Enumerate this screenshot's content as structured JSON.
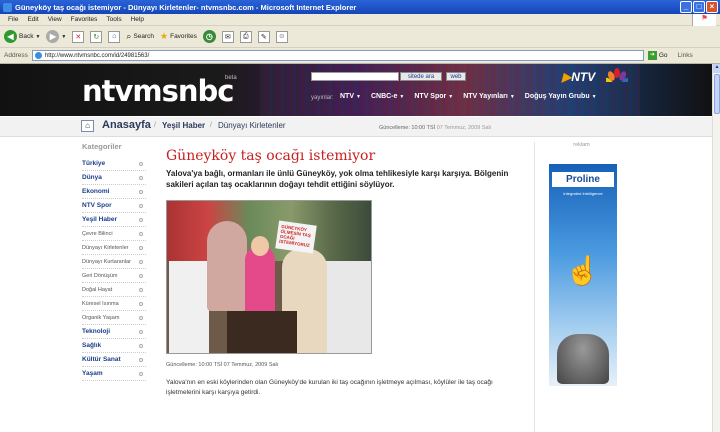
{
  "window": {
    "title": "Güneyköy taş ocağı istemiyor - Dünyayı Kirletenler- ntvmsnbc.com - Microsoft Internet Explorer",
    "controls": [
      "_",
      "□",
      "×"
    ]
  },
  "menu": [
    "File",
    "Edit",
    "View",
    "Favorites",
    "Tools",
    "Help"
  ],
  "toolbar": {
    "back": "Back",
    "search": "Search",
    "favorites": "Favorites"
  },
  "address": {
    "label": "Address",
    "url": "http://www.ntvmsnbc.com/id/24981563/",
    "go": "Go",
    "links": "Links"
  },
  "site": {
    "logo": "ntvmsnbc",
    "logo_sup": "beta",
    "search_button": "sitede ara",
    "web_button": "web",
    "ntv_brand": "NTV",
    "nav_prefix": "yayınlar:",
    "nav": [
      "NTV",
      "CNBC-e",
      "NTV Spor",
      "NTV Yayınları",
      "Doğuş Yayın Grubu"
    ]
  },
  "breadcrumb": {
    "home": "Anasayfa",
    "level2": "Yeşil Haber",
    "level3": "Dünyayı Kirletenler",
    "update_label": "Güncelleme: 10:00 TSİ",
    "update_date": "07 Temmuz, 2009 Salı"
  },
  "sidebar": {
    "title": "Kategoriler",
    "items": [
      {
        "label": "Türkiye",
        "sub": false
      },
      {
        "label": "Dünya",
        "sub": false
      },
      {
        "label": "Ekonomi",
        "sub": false
      },
      {
        "label": "NTV Spor",
        "sub": false
      },
      {
        "label": "Yeşil Haber",
        "sub": false
      },
      {
        "label": "Çevre Bilinci",
        "sub": true
      },
      {
        "label": "Dünyayı Kirletenler",
        "sub": true
      },
      {
        "label": "Dünyayı Kurtaranlar",
        "sub": true
      },
      {
        "label": "Geri Dönüşüm",
        "sub": true
      },
      {
        "label": "Doğal Hayat",
        "sub": true
      },
      {
        "label": "Küresel Isınma",
        "sub": true
      },
      {
        "label": "Organik Yaşam",
        "sub": true
      },
      {
        "label": "Teknoloji",
        "sub": false
      },
      {
        "label": "Sağlık",
        "sub": false
      },
      {
        "label": "Kültür Sanat",
        "sub": false
      },
      {
        "label": "Yaşam",
        "sub": false
      }
    ]
  },
  "article": {
    "headline": "Güneyköy taş ocağı istemiyor",
    "lead": "Yalova'ya bağlı, ormanları ile ünlü Güneyköy, yok olma tehlikesiyle karşı karşıya. Bölgenin sakileri açılan taş ocaklarının doğayı tehdit ettiğini söylüyor.",
    "photo_sign": "GÜNEYKÖY ÖLMESİN TAŞ OCAĞI İSTEMİYORUZ",
    "caption": "Güncelleme: 10:00 TSİ 07 Temmuz, 2009 Salı",
    "body": "Yalova'nın en eski köylerinden olan Güneyköy'de kurulan iki taş ocağının işletmeye açılması, köylüler ile taş ocağı işletmelerini karşı karşıya getirdi."
  },
  "ad": {
    "label": "reklam",
    "brand": "Proline",
    "tagline": "Integrated Intelligence"
  }
}
